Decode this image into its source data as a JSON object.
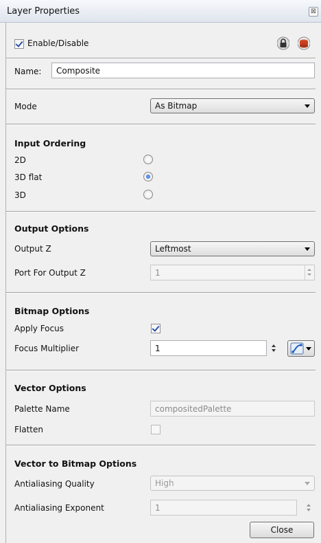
{
  "window": {
    "title": "Layer Properties",
    "close_glyph": "⊠"
  },
  "enable": {
    "label": "Enable/Disable",
    "checked": true,
    "icons": [
      "lock-icon",
      "color-swatch-icon"
    ]
  },
  "name": {
    "label": "Name:",
    "value": "Composite"
  },
  "mode": {
    "label": "Mode",
    "value": "As Bitmap"
  },
  "input_ordering": {
    "title": "Input Ordering",
    "options": [
      {
        "label": "2D",
        "selected": false
      },
      {
        "label": "3D flat",
        "selected": true
      },
      {
        "label": "3D",
        "selected": false
      }
    ]
  },
  "output_options": {
    "title": "Output Options",
    "output_z": {
      "label": "Output Z",
      "value": "Leftmost"
    },
    "port": {
      "label": "Port For Output Z",
      "value": "1"
    }
  },
  "bitmap_options": {
    "title": "Bitmap Options",
    "apply_focus": {
      "label": "Apply Focus",
      "checked": true
    },
    "focus_multiplier": {
      "label": "Focus Multiplier",
      "value": "1",
      "icons": [
        "function-curve-icon"
      ]
    }
  },
  "vector_options": {
    "title": "Vector Options",
    "palette": {
      "label": "Palette Name",
      "value": "compositedPalette"
    },
    "flatten": {
      "label": "Flatten",
      "checked": false
    }
  },
  "vector_to_bitmap": {
    "title": "Vector to Bitmap Options",
    "quality": {
      "label": "Antialiasing Quality",
      "value": "High"
    },
    "exponent": {
      "label": "Antialiasing Exponent",
      "value": "1"
    }
  },
  "footer": {
    "close_label": "Close"
  },
  "colors": {
    "accent": "#1b57c4",
    "titlebar": "#dfe5ee",
    "panel": "#f0f0f0"
  }
}
